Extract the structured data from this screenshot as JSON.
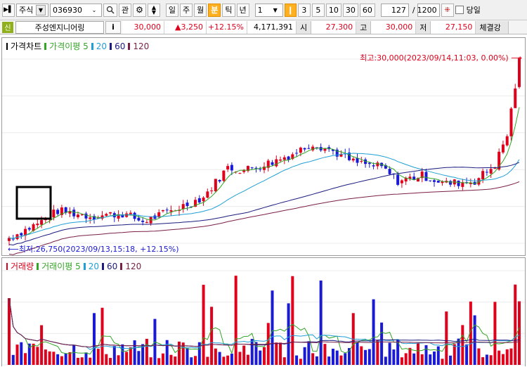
{
  "toolbar": {
    "market_label": "주식",
    "code_value": "036930",
    "watch_label": "관",
    "periods": [
      "일",
      "주",
      "월",
      "분",
      "틱",
      "년"
    ],
    "active_period": "분",
    "interval_value": "1",
    "interval_buttons": [
      "3",
      "5",
      "10",
      "30",
      "60"
    ],
    "count_value": "127",
    "slash": "/",
    "total_value": "1200",
    "today_label": "당일"
  },
  "quote": {
    "badge": "신",
    "name": "주성엔지니어링",
    "info_label": "i",
    "price": "30,000",
    "change": "▲3,250",
    "change_pct": "+12.15%",
    "volume": "4,171,391",
    "open_label": "시",
    "open": "27,300",
    "high_label": "고",
    "high": "30,000",
    "low_label": "저",
    "low": "27,150",
    "tail_label": "체결강"
  },
  "price_panel": {
    "legend_title": "가격차트",
    "legend_ma_prefix": "가격이평 5",
    "legend_ma": [
      "20",
      "60",
      "120"
    ],
    "high_annotation": "최고:30,000(2023/09/14,11:03, 0.00%)",
    "low_annotation": "최저:26,750(2023/09/13,15:18, +12.15%)"
  },
  "volume_panel": {
    "legend_title": "거래량",
    "legend_ma_prefix": "거래이평 5",
    "legend_ma": [
      "20",
      "60",
      "120"
    ]
  },
  "colors": {
    "up": "#e0001b",
    "down": "#1a1ad4",
    "ma5": "#33a626",
    "ma20": "#1f9fd6",
    "ma60": "#1b1b80",
    "ma120": "#7a1f46"
  },
  "chart_data": [
    {
      "type": "candlestick",
      "title": "가격차트",
      "y_high": 30000,
      "y_low": 26750,
      "series": [
        {
          "name": "가격이평 5"
        },
        {
          "name": "20"
        },
        {
          "name": "60"
        },
        {
          "name": "120"
        }
      ]
    },
    {
      "type": "bar",
      "title": "거래량",
      "series": [
        {
          "name": "거래이평 5"
        },
        {
          "name": "20"
        },
        {
          "name": "60"
        },
        {
          "name": "120"
        }
      ]
    }
  ]
}
